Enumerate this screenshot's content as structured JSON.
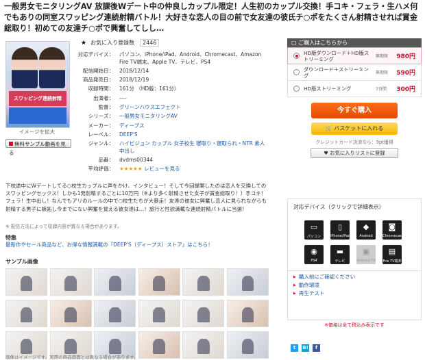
{
  "title": "一般男女モニタリングAV 放課後Wデート中の仲良しカップル限定！人生初のカップル交換！手コキ・フェラ・生ハメ何でもありの同室スワッピング連続射精バトル！大好きな恋人の目の前で女友達の彼氏チ○ポをたくさん射精させれば賞金総取り！初めての友達チ○ポで興奮してしし…",
  "cover": {
    "band_text": "スワッピング連続射精",
    "enlarge": "イメージを拡大"
  },
  "sample_button": "無料サンプル動画を見る",
  "favorites": {
    "label": "お気に入り登録数",
    "count": "2446"
  },
  "info": [
    {
      "label": "対応デバイス：",
      "value": "パソコン、iPhone/iPad、Android、Chromecast、Amazon Fire TV端末、Apple TV、テレビ、PS4",
      "link": false
    },
    {
      "label": "配信開始日：",
      "value": "2018/12/14",
      "link": false
    },
    {
      "label": "商品発売日：",
      "value": "2018/12/19",
      "link": false
    },
    {
      "label": "収録時間：",
      "value": "161分 （HD版：161分）",
      "link": false
    },
    {
      "label": "出演者：",
      "value": "----",
      "link": false
    },
    {
      "label": "監督：",
      "value": "グリーンハウスエフェクト",
      "link": true
    },
    {
      "label": "シリーズ：",
      "value": "一般男女モニタリングAV",
      "link": true
    },
    {
      "label": "メーカー：",
      "value": "ディープス",
      "link": true
    },
    {
      "label": "レーベル：",
      "value": "DEEP'S",
      "link": true
    },
    {
      "label": "ジャンル：",
      "value": "ハイビジョン  カップル  女子校生  寝取り・寝取られ・NTR  素人  中出し",
      "link": true
    },
    {
      "label": "品番：",
      "value": "dvdms00344",
      "link": false
    }
  ],
  "rating": {
    "label": "平均評価：",
    "stars": "★★★★★",
    "link": "レビューを見る"
  },
  "description": "下校途中にWデートしてる○校生カップルに声をかけ、インタビュー！そして今回提案したのは恋人を交換してのスワッピングセックス！しかも1発射精するごとに10万円（※より多く射精させた女子が賞金総取り！）手コキ！フェラ！生中出し！なんでもアリのルールの中で○校生たちが大暴走！友達の彼女に興奮し恋人に見られながらも射精する男子に嫉妬し今までにない興奮を覚える彼女達は…！旅行と性欲満載な連続射精バトルに当選！",
  "note": "※ 配信方法によって収録内容が異なる場合があります。",
  "feature": {
    "heading": "特集",
    "link": "最新作やセール商品など、お得な情報満載の『DEEP'S（ディープス）ストア』はこちら！"
  },
  "sample_heading": "サンプル画像",
  "thumb_count": 18,
  "image_note": "画像はイメージです。実際の商品画面とは異なる場合があります。",
  "purchase": {
    "header": "ご購入はこちらから",
    "options": [
      {
        "name": "HD版ダウンロード＋HD版ストリーミング",
        "limit": "無期限",
        "price": "980円",
        "selected": true
      },
      {
        "name": "ダウンロード＋ストリーミング",
        "limit": "無期限",
        "price": "590円",
        "selected": false
      },
      {
        "name": "HD版ストリーミング",
        "limit": "7日間",
        "price": "300円",
        "selected": false
      }
    ],
    "buy": "今すぐ購入",
    "cart": "バスケットに入れる",
    "credit": "クレジットカード決済なら：9pt獲得",
    "add_fav": "お気に入りリストに登録"
  },
  "devices": {
    "header": "対応デバイス（クリックで詳細表示）",
    "items": [
      {
        "label": "パソコン",
        "icon": "pc-icon",
        "glyph": "▭",
        "enabled": true
      },
      {
        "label": "iPhone/iPad",
        "icon": "iphone-icon",
        "glyph": "▯",
        "enabled": true
      },
      {
        "label": "Android",
        "icon": "android-icon",
        "glyph": "◆",
        "enabled": true
      },
      {
        "label": "Chromecast",
        "icon": "chromecast-icon",
        "glyph": "◙",
        "enabled": true
      },
      {
        "label": "PS4",
        "icon": "ps4-icon",
        "glyph": "◉",
        "enabled": true
      },
      {
        "label": "テレビ",
        "icon": "tv-icon",
        "glyph": "▬",
        "enabled": true
      },
      {
        "label": "Android TV",
        "icon": "android-tv-icon",
        "glyph": "▣",
        "enabled": false
      },
      {
        "label": "Fire TV端末",
        "icon": "fire-tv-icon",
        "glyph": "▤",
        "enabled": true
      }
    ]
  },
  "links": [
    "購入前にご確認ください",
    "動作環境",
    "再生テスト"
  ],
  "tax_note": "※価格は全て税込み表示です",
  "share": [
    {
      "name": "twitter-icon",
      "glyph": "t",
      "color": "#1da1f2"
    },
    {
      "name": "hatena-icon",
      "glyph": "B!",
      "color": "#00a4de"
    },
    {
      "name": "facebook-icon",
      "glyph": "f",
      "color": "#3b5998"
    }
  ]
}
